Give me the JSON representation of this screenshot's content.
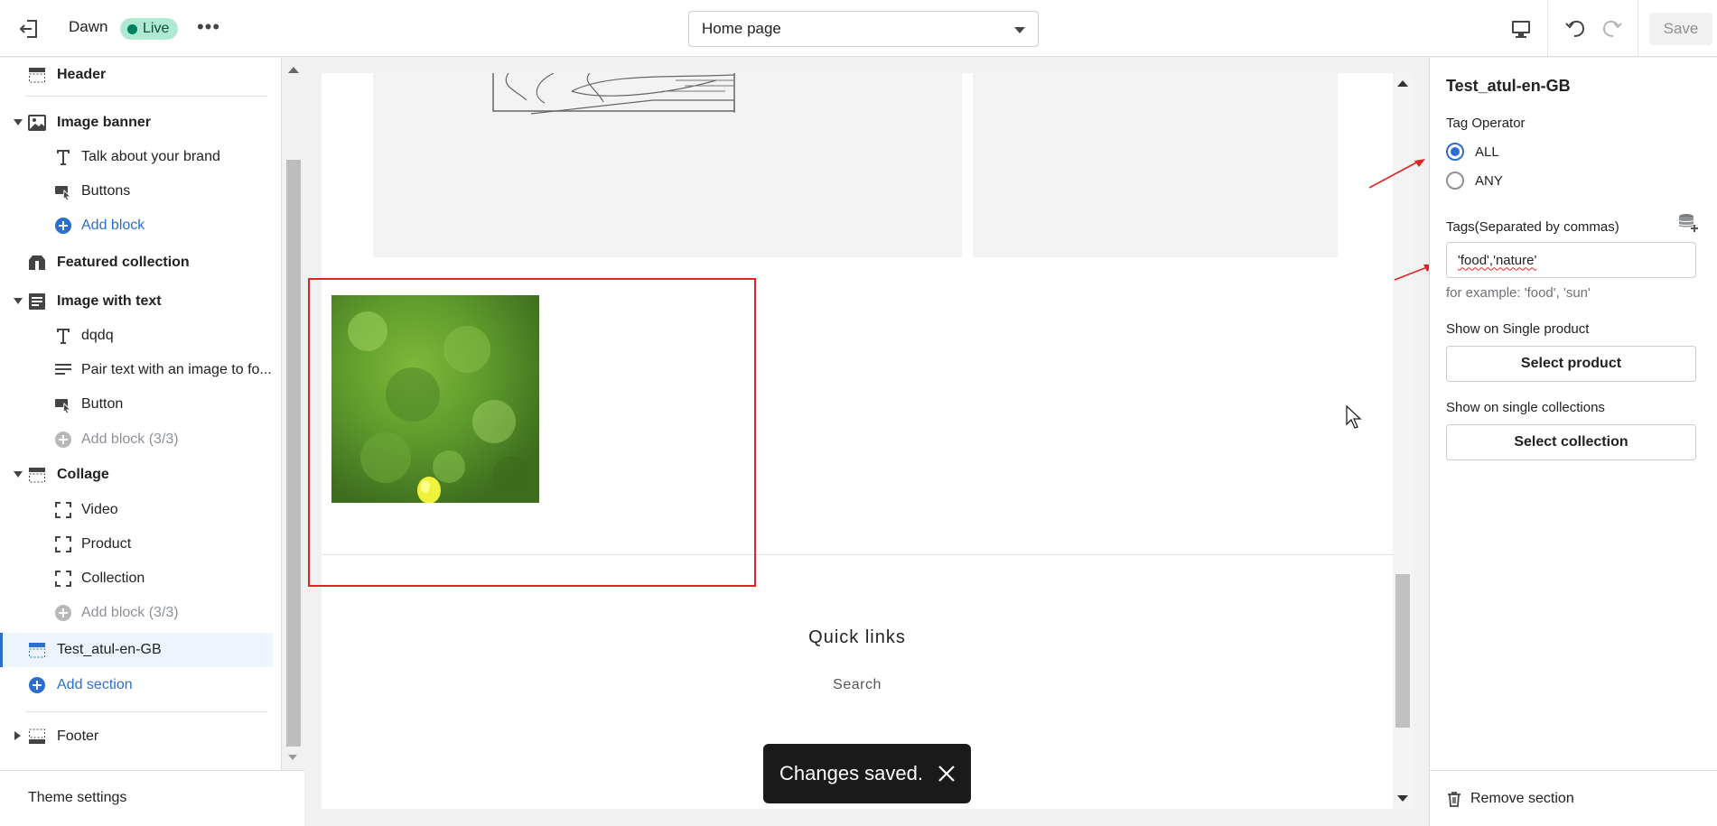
{
  "topbar": {
    "theme_name": "Dawn",
    "live_badge": "Live",
    "more_icon": "more-horizontal-icon",
    "page_select": "Home page",
    "save_label": "Save"
  },
  "sidebar": {
    "header": "Header",
    "image_banner": "Image banner",
    "image_banner_blocks": [
      "Talk about your brand",
      "Buttons"
    ],
    "add_block": "Add block",
    "featured_collection": "Featured collection",
    "image_with_text": "Image with text",
    "image_with_text_blocks": [
      "dqdq",
      "Pair text with an image to fo...",
      "Button"
    ],
    "add_block_disabled": "Add block (3/3)",
    "collage": "Collage",
    "collage_blocks": [
      "Video",
      "Product",
      "Collection"
    ],
    "test_section": "Test_atul-en-GB",
    "add_section": "Add section",
    "footer": "Footer",
    "theme_settings": "Theme settings"
  },
  "preview": {
    "quick_links_title": "Quick links",
    "quick_links_item": "Search",
    "toast": "Changes saved."
  },
  "settings": {
    "title": "Test_atul-en-GB",
    "tag_operator_label": "Tag Operator",
    "radio_all": "ALL",
    "radio_any": "ANY",
    "selected_operator": "ALL",
    "tags_label": "Tags(Separated by commas)",
    "tags_value": "'food','nature'",
    "tags_help": "for example: 'food', 'sun'",
    "single_product_label": "Show on Single product",
    "select_product": "Select product",
    "single_collections_label": "Show on single collections",
    "select_collection": "Select collection",
    "remove_section": "Remove section"
  },
  "colors": {
    "accent": "#2c6ecb",
    "live_badge_bg": "#aee9d1",
    "annotation": "#e02424",
    "toast_bg": "#1a1a1a"
  }
}
